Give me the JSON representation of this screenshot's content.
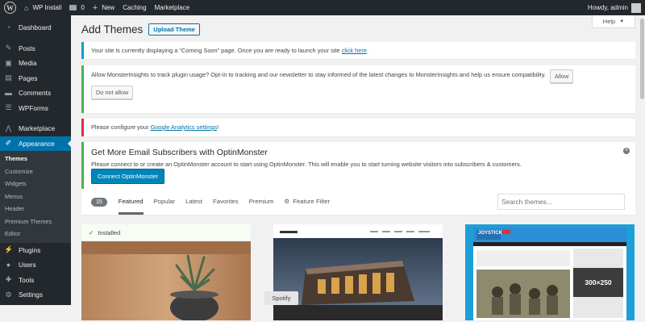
{
  "adminbar": {
    "site_name": "WP Install",
    "comments_count": "0",
    "new_label": "New",
    "caching_label": "Caching",
    "marketplace_label": "Marketplace",
    "howdy": "Howdy, admin"
  },
  "sidebar": {
    "dashboard": "Dashboard",
    "posts": "Posts",
    "media": "Media",
    "pages": "Pages",
    "comments": "Comments",
    "wpforms": "WPForms",
    "marketplace": "Marketplace",
    "appearance": "Appearance",
    "submenu": [
      "Themes",
      "Customize",
      "Widgets",
      "Menus",
      "Header",
      "Premium Themes",
      "Editor"
    ],
    "plugins": "Plugins",
    "users": "Users",
    "tools": "Tools",
    "settings": "Settings"
  },
  "help_label": "Help",
  "page_title": "Add Themes",
  "upload_theme": "Upload Theme",
  "notices": {
    "coming_soon_text": "Your site is currently displaying a “Coming Soon” page. Once you are ready to launch your site",
    "coming_soon_link": "click here",
    "monsterinsights_text": "Allow MonsterInsights to track plugin usage? Opt-in to tracking and our newsletter to stay informed of the latest changes to MonsterInsights and help us ensure compatibility.",
    "allow": "Allow",
    "do_not_allow": "Do not allow",
    "analytics_text": "Please configure your",
    "analytics_link": "Google Analytics settings",
    "optin_title": "Get More Email Subscribers with OptinMonster",
    "optin_text": "Please connect to or create an OptinMonster account to start using OptinMonster. This will enable you to start turning website visitors into subscribers & customers.",
    "optin_button": "Connect OptinMonster"
  },
  "filter": {
    "count": "15",
    "tabs": [
      "Featured",
      "Popular",
      "Latest",
      "Favorites",
      "Premium"
    ],
    "feature_filter": "Feature Filter",
    "search_placeholder": "Search themes..."
  },
  "themes": {
    "installed_label": "Installed",
    "joystick_logo": "JOYSTICK",
    "ad_size": "300×250"
  },
  "tooltip": "Spotify",
  "colors": {
    "adminbar": "#23282d",
    "accent": "#0073aa",
    "notice_info": "#00a0d2",
    "notice_success": "#46b450",
    "notice_error": "#dc3232"
  }
}
